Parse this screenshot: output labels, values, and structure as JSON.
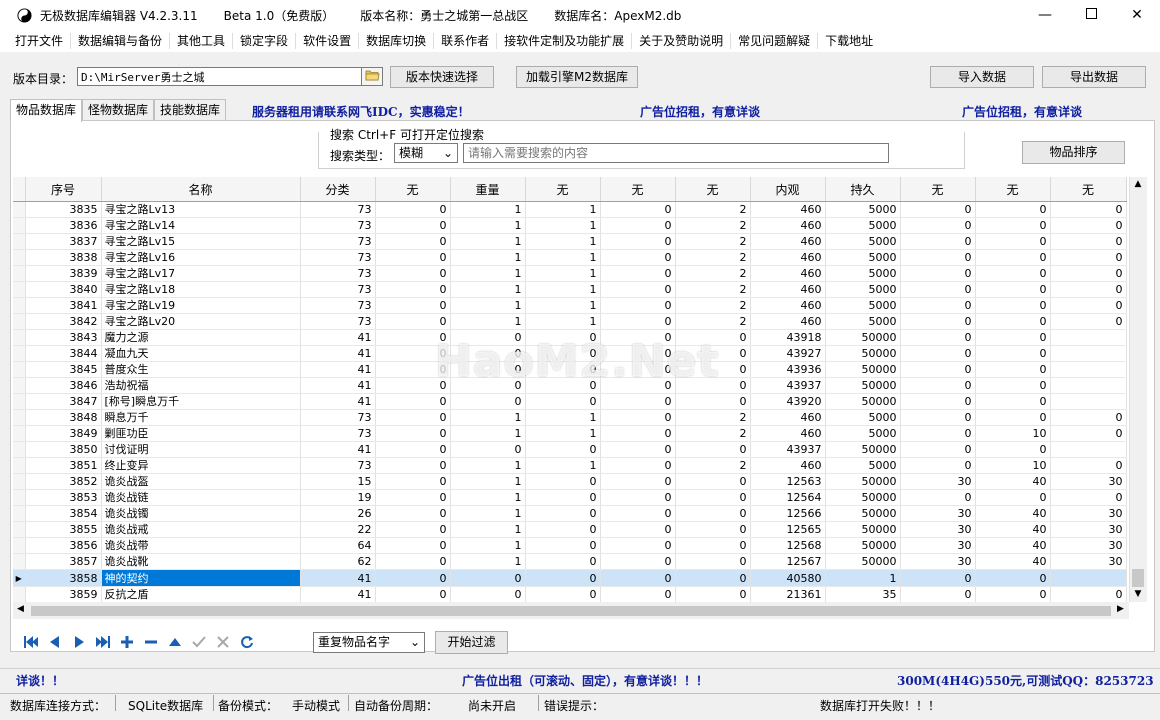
{
  "title": {
    "app": "无极数据库编辑器 V4.2.3.11",
    "edition": "Beta 1.0（免费版）",
    "version_name": "版本名称：勇士之城第一总战区",
    "db_name": "数据库名：ApexM2.db"
  },
  "menu": [
    "打开文件",
    "数据编辑与备份",
    "其他工具",
    "锁定字段",
    "软件设置",
    "数据库切换",
    "联系作者",
    "接软件定制及功能扩展",
    "关于及赞助说明",
    "常见问题解疑",
    "下载地址"
  ],
  "toolbar": {
    "dir_label": "版本目录：",
    "dir_value": "D:\\MirServer勇士之城",
    "quick_select": "版本快速选择",
    "load_engine": "加载引擎M2数据库",
    "import": "导入数据",
    "export": "导出数据"
  },
  "tabs": [
    "物品数据库",
    "怪物数据库",
    "技能数据库"
  ],
  "ads": {
    "server": "服务器租用请联系网飞IDC，实惠稳定！",
    "ad1": "广告位招租，有意详谈",
    "ad2": "广告位招租，有意详谈"
  },
  "search": {
    "title": "搜索  Ctrl+F 可打开定位搜索",
    "type_label": "搜索类型：",
    "type_value": "模糊",
    "placeholder": "请输入需要搜索的内容",
    "sort_button": "物品排序"
  },
  "columns": [
    "序号",
    "名称",
    "分类",
    "无",
    "重量",
    "无",
    "无",
    "无",
    "内观",
    "持久",
    "无",
    "无",
    "无"
  ],
  "rows": [
    [
      "3835",
      "寻宝之路Lv13",
      "73",
      "0",
      "1",
      "1",
      "0",
      "2",
      "460",
      "5000",
      "0",
      "0",
      "0"
    ],
    [
      "3836",
      "寻宝之路Lv14",
      "73",
      "0",
      "1",
      "1",
      "0",
      "2",
      "460",
      "5000",
      "0",
      "0",
      "0"
    ],
    [
      "3837",
      "寻宝之路Lv15",
      "73",
      "0",
      "1",
      "1",
      "0",
      "2",
      "460",
      "5000",
      "0",
      "0",
      "0"
    ],
    [
      "3838",
      "寻宝之路Lv16",
      "73",
      "0",
      "1",
      "1",
      "0",
      "2",
      "460",
      "5000",
      "0",
      "0",
      "0"
    ],
    [
      "3839",
      "寻宝之路Lv17",
      "73",
      "0",
      "1",
      "1",
      "0",
      "2",
      "460",
      "5000",
      "0",
      "0",
      "0"
    ],
    [
      "3840",
      "寻宝之路Lv18",
      "73",
      "0",
      "1",
      "1",
      "0",
      "2",
      "460",
      "5000",
      "0",
      "0",
      "0"
    ],
    [
      "3841",
      "寻宝之路Lv19",
      "73",
      "0",
      "1",
      "1",
      "0",
      "2",
      "460",
      "5000",
      "0",
      "0",
      "0"
    ],
    [
      "3842",
      "寻宝之路Lv20",
      "73",
      "0",
      "1",
      "1",
      "0",
      "2",
      "460",
      "5000",
      "0",
      "0",
      "0"
    ],
    [
      "3843",
      "魔力之源",
      "41",
      "0",
      "0",
      "0",
      "0",
      "0",
      "43918",
      "50000",
      "0",
      "0",
      ""
    ],
    [
      "3844",
      "凝血九天",
      "41",
      "0",
      "0",
      "0",
      "0",
      "0",
      "43927",
      "50000",
      "0",
      "0",
      ""
    ],
    [
      "3845",
      "普度众生",
      "41",
      "0",
      "0",
      "0",
      "0",
      "0",
      "43936",
      "50000",
      "0",
      "0",
      ""
    ],
    [
      "3846",
      "浩劫祝福",
      "41",
      "0",
      "0",
      "0",
      "0",
      "0",
      "43937",
      "50000",
      "0",
      "0",
      ""
    ],
    [
      "3847",
      "[称号]瞬息万千",
      "41",
      "0",
      "0",
      "0",
      "0",
      "0",
      "43920",
      "50000",
      "0",
      "0",
      ""
    ],
    [
      "3848",
      "瞬息万千",
      "73",
      "0",
      "1",
      "1",
      "0",
      "2",
      "460",
      "5000",
      "0",
      "0",
      "0"
    ],
    [
      "3849",
      "剿匪功臣",
      "73",
      "0",
      "1",
      "1",
      "0",
      "2",
      "460",
      "5000",
      "0",
      "10",
      "0"
    ],
    [
      "3850",
      "讨伐证明",
      "41",
      "0",
      "0",
      "0",
      "0",
      "0",
      "43937",
      "50000",
      "0",
      "0",
      ""
    ],
    [
      "3851",
      "终止变异",
      "73",
      "0",
      "1",
      "1",
      "0",
      "2",
      "460",
      "5000",
      "0",
      "10",
      "0"
    ],
    [
      "3852",
      "诡炎战盔",
      "15",
      "0",
      "1",
      "0",
      "0",
      "0",
      "12563",
      "50000",
      "30",
      "40",
      "30"
    ],
    [
      "3853",
      "诡炎战链",
      "19",
      "0",
      "1",
      "0",
      "0",
      "0",
      "12564",
      "50000",
      "0",
      "0",
      "0"
    ],
    [
      "3854",
      "诡炎战镯",
      "26",
      "0",
      "1",
      "0",
      "0",
      "0",
      "12566",
      "50000",
      "30",
      "40",
      "30"
    ],
    [
      "3855",
      "诡炎战戒",
      "22",
      "0",
      "1",
      "0",
      "0",
      "0",
      "12565",
      "50000",
      "30",
      "40",
      "30"
    ],
    [
      "3856",
      "诡炎战带",
      "64",
      "0",
      "1",
      "0",
      "0",
      "0",
      "12568",
      "50000",
      "30",
      "40",
      "30"
    ],
    [
      "3857",
      "诡炎战靴",
      "62",
      "0",
      "1",
      "0",
      "0",
      "0",
      "12567",
      "50000",
      "30",
      "40",
      "30"
    ],
    [
      "3858",
      "神的契约",
      "41",
      "0",
      "0",
      "0",
      "0",
      "0",
      "40580",
      "1",
      "0",
      "0",
      ""
    ],
    [
      "3859",
      "反抗之盾",
      "41",
      "0",
      "0",
      "0",
      "0",
      "0",
      "21361",
      "35",
      "0",
      "0",
      "0"
    ]
  ],
  "filter": {
    "dropdown": "重复物品名字",
    "start_button": "开始过滤"
  },
  "bottom_ads": {
    "left": "详谈！！",
    "center": "广告位出租（可滚动、固定），有意详谈！！！",
    "right": "300M(4H4G)550元,可测试QQ：8253723"
  },
  "status": {
    "conn_label": "数据库连接方式：",
    "conn_value": "SQLite数据库",
    "backup_label": "备份模式：",
    "backup_value": "手动模式",
    "auto_label": "自动备份周期：",
    "auto_value": "尚未开启",
    "error_label": "错误提示：",
    "error_value": "数据库打开失败！！！"
  },
  "watermark": "HaoM2.Net",
  "colors": {
    "selection": "#0078d7",
    "ad_text": "#1020a0",
    "nav_icon": "#1a5fb4"
  }
}
